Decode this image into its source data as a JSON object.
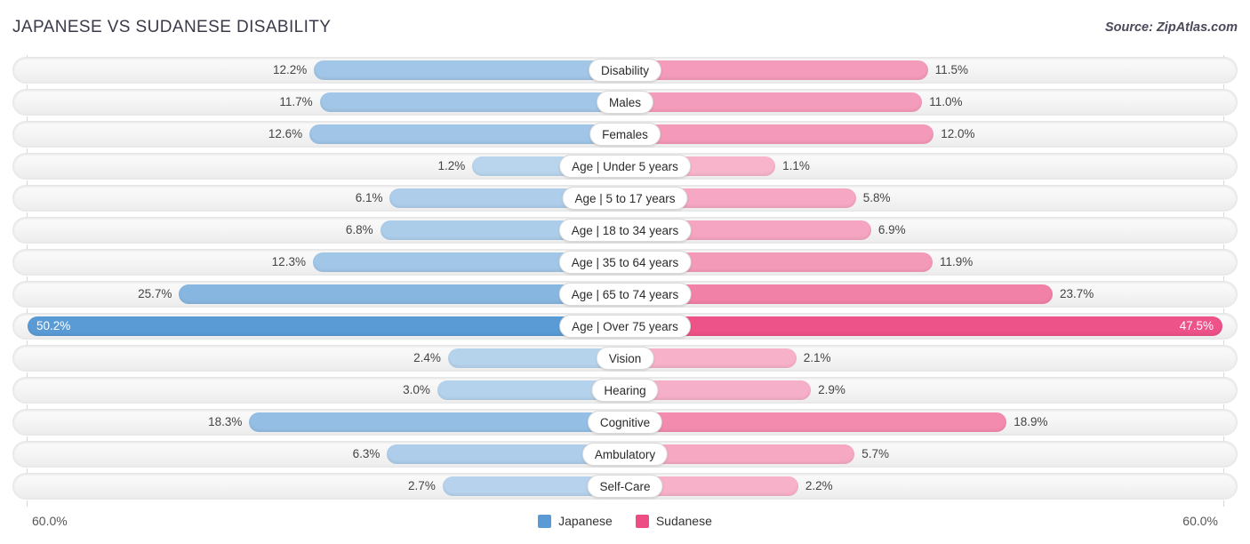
{
  "header": {
    "title": "JAPANESE VS SUDANESE DISABILITY",
    "source": "Source: ZipAtlas.com"
  },
  "legend": {
    "items": [
      {
        "label": "Japanese",
        "color": "#5b9bd5"
      },
      {
        "label": "Sudanese",
        "color": "#ec4d85"
      }
    ]
  },
  "axis": {
    "left_label": "60.0%",
    "right_label": "60.0%",
    "max": 60.0
  },
  "chart_data": {
    "type": "bar",
    "orientation": "horizontal-diverging",
    "title": "JAPANESE VS SUDANESE DISABILITY",
    "xlabel": "",
    "ylabel": "",
    "xlim": [
      60.0,
      60.0
    ],
    "grid": true,
    "legend_position": "bottom-center",
    "categories": [
      "Disability",
      "Males",
      "Females",
      "Age | Under 5 years",
      "Age | 5 to 17 years",
      "Age | 18 to 34 years",
      "Age | 35 to 64 years",
      "Age | 65 to 74 years",
      "Age | Over 75 years",
      "Vision",
      "Hearing",
      "Cognitive",
      "Ambulatory",
      "Self-Care"
    ],
    "series": [
      {
        "name": "Japanese",
        "color": "#5b9bd5",
        "values": [
          12.2,
          11.7,
          12.6,
          1.2,
          6.1,
          6.8,
          12.3,
          25.7,
          50.2,
          2.4,
          3.0,
          18.3,
          6.3,
          2.7
        ],
        "labels": [
          "12.2%",
          "11.7%",
          "12.6%",
          "1.2%",
          "6.1%",
          "6.8%",
          "12.3%",
          "25.7%",
          "50.2%",
          "2.4%",
          "3.0%",
          "18.3%",
          "6.3%",
          "2.7%"
        ]
      },
      {
        "name": "Sudanese",
        "color": "#ec4d85",
        "values": [
          11.5,
          11.0,
          12.0,
          1.1,
          5.8,
          6.9,
          11.9,
          23.7,
          47.5,
          2.1,
          2.9,
          18.9,
          5.7,
          2.2
        ],
        "labels": [
          "11.5%",
          "11.0%",
          "12.0%",
          "1.1%",
          "5.8%",
          "6.9%",
          "11.9%",
          "23.7%",
          "47.5%",
          "2.1%",
          "2.9%",
          "18.9%",
          "5.7%",
          "2.2%"
        ]
      }
    ]
  }
}
